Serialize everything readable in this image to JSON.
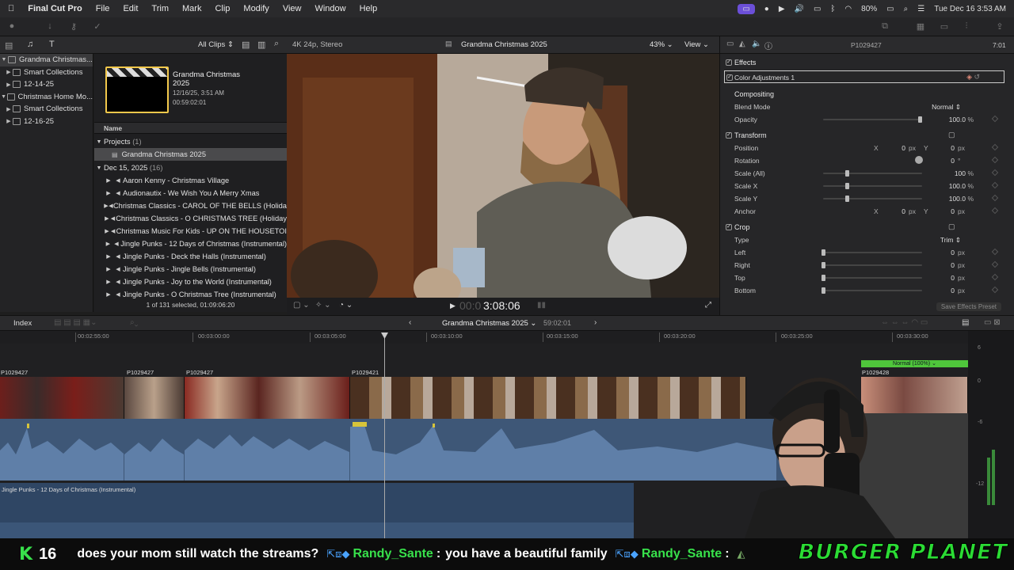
{
  "menubar": {
    "app_name": "Final Cut Pro",
    "items": [
      "File",
      "Edit",
      "Trim",
      "Mark",
      "Clip",
      "Modify",
      "View",
      "Window",
      "Help"
    ],
    "battery": "80%",
    "clock": "Tue Dec 16  3:53 AM"
  },
  "library": {
    "filter": "All Clips",
    "items": [
      {
        "label": "Grandma Christmas..."
      },
      {
        "label": "Smart Collections"
      },
      {
        "label": "12-14-25"
      },
      {
        "label": "Christmas Home Mo..."
      },
      {
        "label": "Smart Collections"
      },
      {
        "label": "12-16-25"
      }
    ]
  },
  "browser": {
    "project_title": "Grandma Christmas 2025",
    "project_date": "12/16/25, 3:51 AM",
    "project_duration": "00:59:02:01",
    "column_header": "Name",
    "projects_label": "Projects",
    "projects_count": "(1)",
    "project_row": "Grandma Christmas 2025",
    "date_group": "Dec 15, 2025",
    "date_count": "(16)",
    "clips": [
      "Aaron Kenny - Christmas Village",
      "Audionautix - We Wish You A Merry Xmas",
      "Christmas Classics - CAROL OF THE BELLS (Holida",
      "Christmas Classics - O CHRISTMAS TREE (Holiday",
      "Christmas Music For Kids - UP ON THE HOUSETOI",
      "Jingle Punks - 12 Days of Christmas (Instrumental)",
      "Jingle Punks - Deck the Halls (Instrumental)",
      "Jingle Punks - Jingle Bells (Instrumental)",
      "Jingle Punks - Joy to the World (Instrumental)",
      "Jingle Punks - O Christmas Tree (Instrumental)"
    ],
    "status": "1 of 131 selected, 01:09:06:20"
  },
  "viewer": {
    "format": "4K 24p, Stereo",
    "title": "Grandma Christmas 2025",
    "zoom": "43%",
    "view_menu": "View",
    "timecode_dim": "00:0",
    "timecode": "3:08:06"
  },
  "inspector": {
    "clip_name": "P1029427",
    "duration": "7:01",
    "effects_label": "Effects",
    "effect_name": "Color Adjustments 1",
    "compositing_label": "Compositing",
    "blend_mode_label": "Blend Mode",
    "blend_mode_value": "Normal",
    "opacity_label": "Opacity",
    "opacity_value": "100.0",
    "transform_label": "Transform",
    "position_label": "Position",
    "position_x": "0",
    "position_y": "0",
    "rotation_label": "Rotation",
    "rotation_value": "0",
    "scale_all_label": "Scale (All)",
    "scale_all_value": "100",
    "scale_x_label": "Scale X",
    "scale_x_value": "100.0",
    "scale_y_label": "Scale Y",
    "scale_y_value": "100.0",
    "anchor_label": "Anchor",
    "anchor_x": "0",
    "anchor_y": "0",
    "crop_label": "Crop",
    "type_label": "Type",
    "type_value": "Trim",
    "left_label": "Left",
    "left_value": "0",
    "right_label": "Right",
    "right_value": "0",
    "top_label": "Top",
    "top_value": "0",
    "bottom_label": "Bottom",
    "bottom_value": "0",
    "unit_px": "px",
    "unit_pct": "%",
    "unit_deg": "°",
    "x_letter": "X",
    "y_letter": "Y",
    "save_preset": "Save Effects Preset"
  },
  "timeline": {
    "index_label": "Index",
    "project_name": "Grandma Christmas 2025",
    "project_duration": "59:02:01",
    "ruler": [
      "00:02:55:00",
      "00:03:00:00",
      "00:03:05:00",
      "00:03:10:00",
      "00:03:15:00",
      "00:03:20:00",
      "00:03:25:00",
      "00:03:30:00"
    ],
    "clip_labels": [
      "P1029427",
      "P1029427",
      "P1029427",
      "P1029421",
      "P1029428"
    ],
    "blend_badge": "Normal (100%)",
    "music_label": "Jingle Punks - 12 Days of Christmas (Instrumental)",
    "meter_scale": [
      "6",
      "0",
      "-6",
      "-12"
    ]
  },
  "chat": {
    "k_glyph": "K",
    "k_number": "16",
    "message1": "does your mom still watch the streams?",
    "user1": "Randy_Sante",
    "message2": "you have a beautiful family",
    "user2": "Randy_Sante",
    "brand": "BURGER PLANET"
  }
}
